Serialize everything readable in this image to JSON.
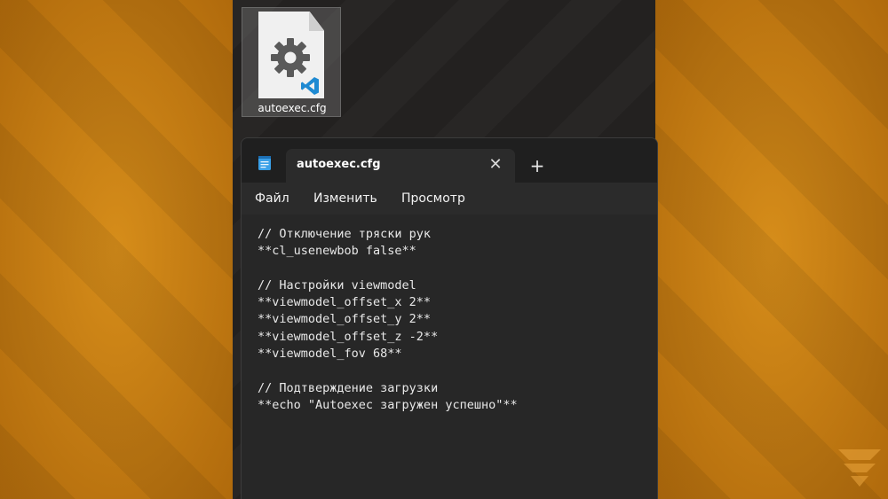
{
  "desktop": {
    "file_name": "autoexec.cfg",
    "file_icon": "gear-icon",
    "badge_icon": "vscode-icon"
  },
  "window": {
    "app_icon": "notepad-icon",
    "tab_title": "autoexec.cfg",
    "close_glyph": "✕",
    "new_tab_glyph": "+"
  },
  "menu": {
    "items": [
      "Файл",
      "Изменить",
      "Просмотр"
    ]
  },
  "editor": {
    "lines": [
      "// Отключение тряски рук",
      "**cl_usenewbob false**",
      "",
      "// Настройки viewmodel",
      "**viewmodel_offset_x 2**",
      "**viewmodel_offset_y 2**",
      "**viewmodel_offset_z -2**",
      "**viewmodel_fov 68**",
      "",
      "// Подтверждение загрузки",
      "**echo \"Autoexec загружен успешно\"**"
    ]
  },
  "colors": {
    "background_orange": "#c67f12",
    "window_bg": "#2b2b2b",
    "titlebar_bg": "#1f1f1f",
    "text": "#e8e8e8",
    "vscode_blue": "#1f8ad2"
  }
}
